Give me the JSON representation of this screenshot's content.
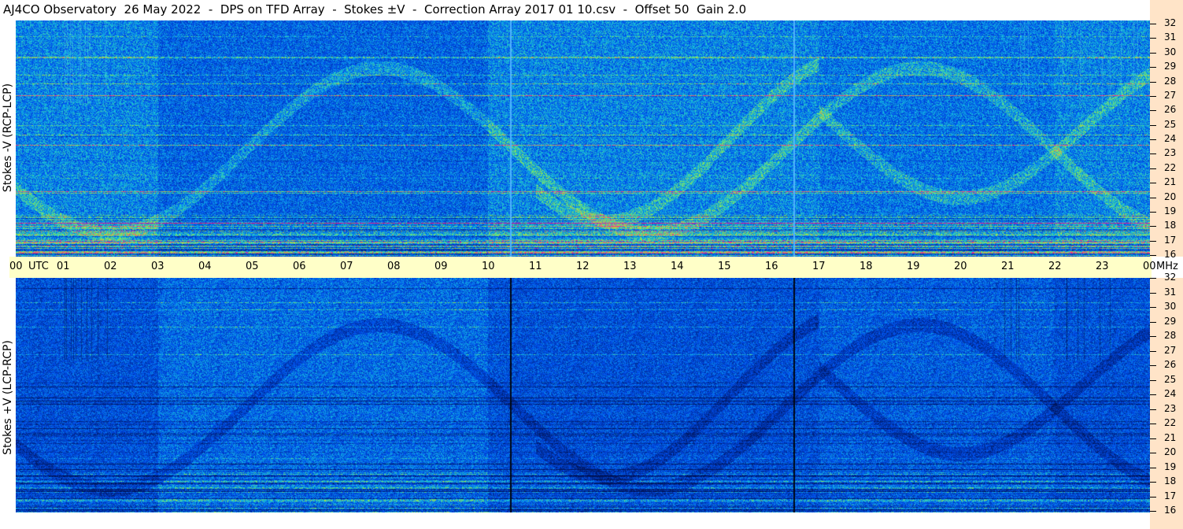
{
  "title": "AJ4CO Observatory  26 May 2022  -  DPS on TFD Array  -  Stokes ±V  -  Correction Array 2017 01 10.csv  -  Offset 50  Gain 2.0",
  "panels": {
    "top": {
      "label": "Stokes -V (RCP-LCP)"
    },
    "bottom": {
      "label": "Stokes +V (LCP-RCP)"
    }
  },
  "time_axis": {
    "start_label": "00",
    "unit_label": "UTC",
    "hours": [
      "01",
      "02",
      "03",
      "04",
      "05",
      "06",
      "07",
      "08",
      "09",
      "10",
      "11",
      "12",
      "13",
      "14",
      "15",
      "16",
      "17",
      "18",
      "19",
      "20",
      "21",
      "22",
      "23"
    ],
    "end_label": "00",
    "end_unit": "MHz"
  },
  "frequency_axis": {
    "top_labels": [
      "32",
      "31",
      "30",
      "29",
      "28",
      "27",
      "26",
      "25",
      "24",
      "23",
      "22",
      "21",
      "20",
      "19",
      "18",
      "17",
      "16"
    ],
    "bottom_labels": [
      "32",
      "31",
      "30",
      "29",
      "28",
      "27",
      "26",
      "25",
      "24",
      "23",
      "22",
      "21",
      "20",
      "19",
      "18",
      "17",
      "16"
    ]
  },
  "colors": {
    "time_axis_bg": "#ffffc8",
    "freq_axis_bg": "#ffe4c8",
    "spectrogram_base": "#1a5ee6"
  }
}
